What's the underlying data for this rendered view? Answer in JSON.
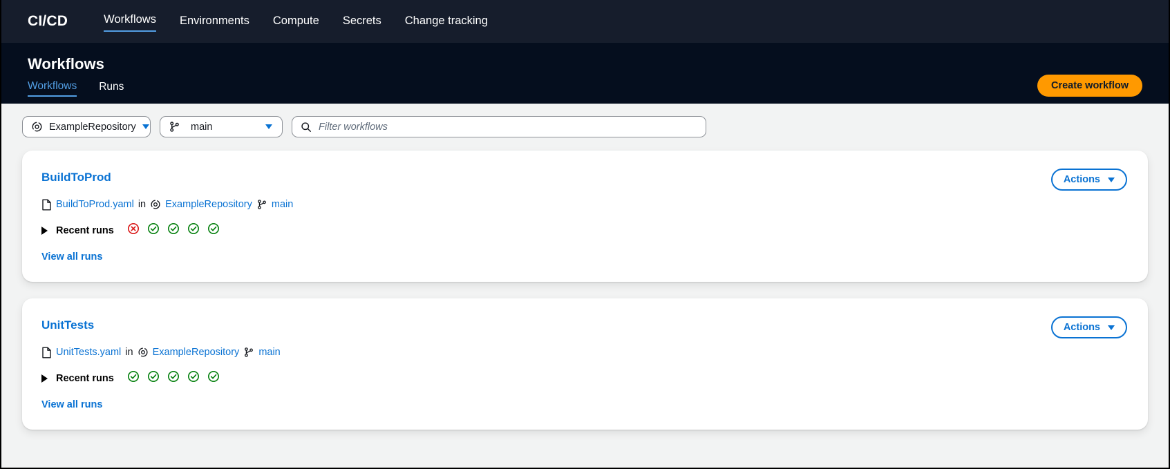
{
  "topnav": {
    "brand": "CI/CD",
    "items": [
      {
        "label": "Workflows",
        "active": true
      },
      {
        "label": "Environments",
        "active": false
      },
      {
        "label": "Compute",
        "active": false
      },
      {
        "label": "Secrets",
        "active": false
      },
      {
        "label": "Change tracking",
        "active": false
      }
    ]
  },
  "header": {
    "title": "Workflows",
    "tabs": [
      {
        "label": "Workflows",
        "active": true
      },
      {
        "label": "Runs",
        "active": false
      }
    ],
    "create_button": "Create workflow"
  },
  "filters": {
    "repository": {
      "value": "ExampleRepository",
      "icon": "repository-icon"
    },
    "branch": {
      "value": "main",
      "icon": "branch-icon"
    },
    "search": {
      "value": "",
      "placeholder": "Filter workflows",
      "icon": "search-icon"
    }
  },
  "workflows": [
    {
      "name": "BuildToProd",
      "file": "BuildToProd.yaml",
      "in_label": "in",
      "repository": "ExampleRepository",
      "branch": "main",
      "recent_runs_label": "Recent runs",
      "run_statuses": [
        "failed",
        "succeeded",
        "succeeded",
        "succeeded",
        "succeeded"
      ],
      "view_all_label": "View all runs",
      "actions_label": "Actions"
    },
    {
      "name": "UnitTests",
      "file": "UnitTests.yaml",
      "in_label": "in",
      "repository": "ExampleRepository",
      "branch": "main",
      "recent_runs_label": "Recent runs",
      "run_statuses": [
        "succeeded",
        "succeeded",
        "succeeded",
        "succeeded",
        "succeeded"
      ],
      "view_all_label": "View all runs",
      "actions_label": "Actions"
    }
  ],
  "colors": {
    "topnav_bg": "#161d2c",
    "header_bg": "#050e1e",
    "page_bg": "#f2f3f3",
    "accent_blue": "#0972d3",
    "link_blue": "#539fe5",
    "orange": "#ff9900",
    "status_success": "#037f0c",
    "status_failed": "#d91515"
  }
}
